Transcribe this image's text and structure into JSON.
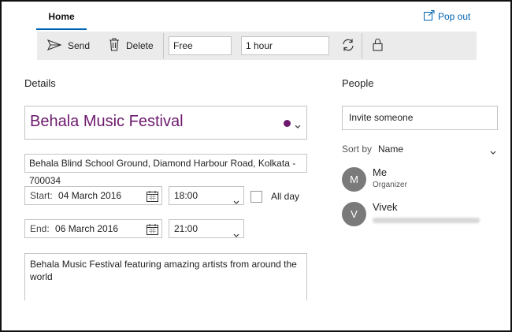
{
  "tabs": {
    "home_label": "Home"
  },
  "popout": {
    "label": "Pop out",
    "icon": "pop-out-icon",
    "color": "#0063b1"
  },
  "toolbar": {
    "send_label": "Send",
    "delete_label": "Delete",
    "show_as_value": "Free",
    "reminder_value": "1 hour",
    "icons": [
      "send-icon",
      "delete-icon",
      "repeat-icon",
      "lock-icon"
    ]
  },
  "details": {
    "heading": "Details",
    "event_title": "Behala Music Festival",
    "title_color": "#6d1a6d",
    "location": "Behala Blind School Ground, Diamond Harbour Road, Kolkata - 700034",
    "start": {
      "label": "Start:",
      "date": "04 March 2016",
      "time": "18:00"
    },
    "end": {
      "label": "End:",
      "date": "06 March 2016",
      "time": "21:00"
    },
    "all_day_label": "All day",
    "all_day_checked": false,
    "description": "Behala Music Festival featuring amazing artists from around the world"
  },
  "people": {
    "heading": "People",
    "invite_placeholder": "Invite someone",
    "sort_label": "Sort by",
    "sort_value": "Name",
    "attendees": [
      {
        "initial": "M",
        "name": "Me",
        "role": "Organizer"
      },
      {
        "initial": "V",
        "name": "Vivek",
        "role": ""
      }
    ]
  }
}
